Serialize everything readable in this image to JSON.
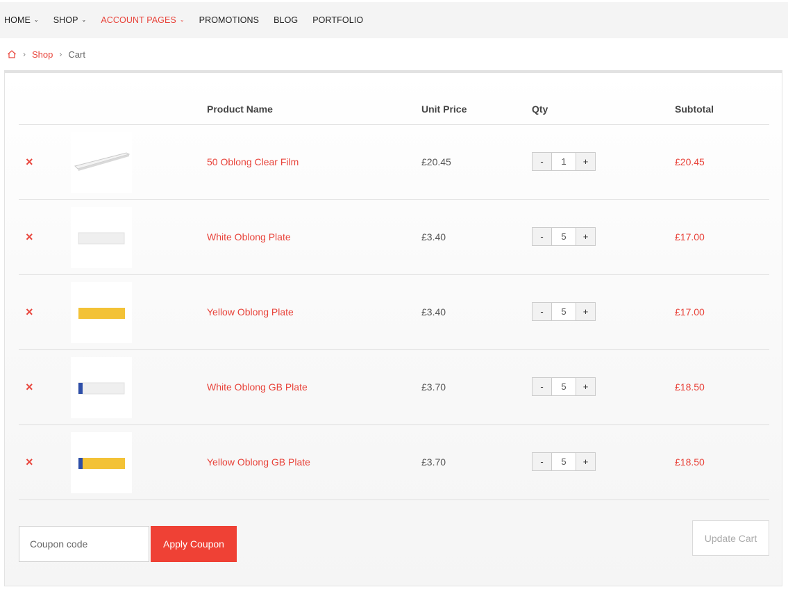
{
  "nav": {
    "items": [
      {
        "label": "HOME",
        "has_dropdown": true,
        "active": false
      },
      {
        "label": "SHOP",
        "has_dropdown": true,
        "active": false
      },
      {
        "label": "ACCOUNT PAGES",
        "has_dropdown": true,
        "active": true
      },
      {
        "label": "PROMOTIONS",
        "has_dropdown": false,
        "active": false
      },
      {
        "label": "BLOG",
        "has_dropdown": false,
        "active": false
      },
      {
        "label": "PORTFOLIO",
        "has_dropdown": false,
        "active": false
      }
    ]
  },
  "breadcrumb": {
    "home_icon": "home-icon",
    "separator": "›",
    "items": [
      {
        "label": "Shop",
        "link": true
      },
      {
        "label": "Cart",
        "link": false
      }
    ]
  },
  "cart": {
    "headers": {
      "product_name": "Product Name",
      "unit_price": "Unit Price",
      "qty": "Qty",
      "subtotal": "Subtotal"
    },
    "remove_icon": "×",
    "qty_minus": "-",
    "qty_plus": "+",
    "rows": [
      {
        "name": "50 Oblong Clear Film",
        "price": "£20.45",
        "qty": "1",
        "subtotal": "£20.45",
        "thumb": "clear-film"
      },
      {
        "name": "White Oblong Plate",
        "price": "£3.40",
        "qty": "5",
        "subtotal": "£17.00",
        "thumb": "white-plate"
      },
      {
        "name": "Yellow Oblong Plate",
        "price": "£3.40",
        "qty": "5",
        "subtotal": "£17.00",
        "thumb": "yellow-plate"
      },
      {
        "name": "White Oblong GB Plate",
        "price": "£3.70",
        "qty": "5",
        "subtotal": "£18.50",
        "thumb": "white-gb-plate"
      },
      {
        "name": "Yellow Oblong GB Plate",
        "price": "£3.70",
        "qty": "5",
        "subtotal": "£18.50",
        "thumb": "yellow-gb-plate"
      }
    ]
  },
  "actions": {
    "coupon_placeholder": "Coupon code",
    "coupon_value": "",
    "apply_label": "Apply Coupon",
    "update_label": "Update Cart"
  },
  "colors": {
    "accent": "#e8433a",
    "button_red": "#ef4135",
    "plate_yellow": "#f3c236",
    "plate_white": "#eeeeee",
    "gb_blue": "#2d4ea8"
  }
}
